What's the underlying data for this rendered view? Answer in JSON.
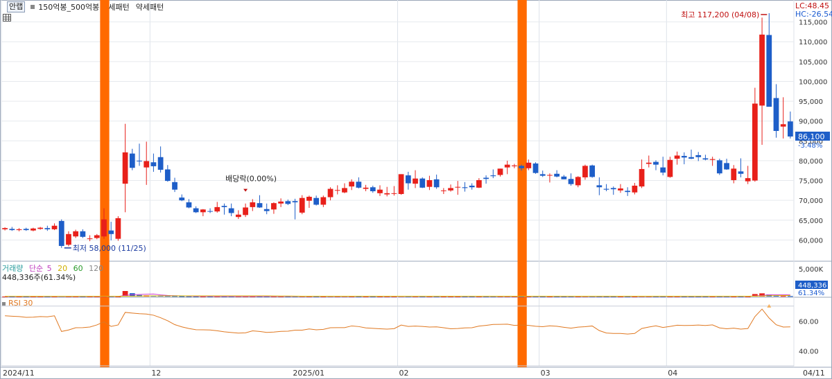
{
  "toolbar": {
    "button_label": "안랩",
    "items": [
      "150억봉_500억봉",
      "강세패턴",
      "약세패턴"
    ]
  },
  "price_panel": {
    "lc_label": "LC:48.45",
    "hc_label": "HC:-26.54",
    "current_price": "86,100",
    "change_pct": "-3.48%",
    "high_annotation": "최고 117,200 (04/08)",
    "low_annotation": "최저 58,000 (11/25)",
    "dividend_annotation": "배당락(0.00%)"
  },
  "volume_panel": {
    "legend": [
      {
        "text": "거래량",
        "color": "#2a9d9d"
      },
      {
        "text": "단순",
        "color": "#c040c0"
      },
      {
        "text": "5",
        "color": "#c040c0"
      },
      {
        "text": "20",
        "color": "#d0b000"
      },
      {
        "text": "60",
        "color": "#2a9a2a"
      },
      {
        "text": "120",
        "color": "#888888"
      }
    ],
    "value_text": "448,336주(61.34%)",
    "axis_badge": "448,336",
    "axis_pct": "61.34%"
  },
  "rsi_panel": {
    "legend": "RSI 30"
  },
  "colors": {
    "up": "#e8201a",
    "down": "#1e5ec8",
    "highlight": "#ff6a00",
    "rsi": "#e07820",
    "ma5": "#d040d0",
    "ma20": "#e0c000"
  },
  "chart_data": [
    {
      "type": "candlestick",
      "title": "",
      "x_tick_labels": [
        "2024/11",
        "12",
        "2025/01",
        "02",
        "03",
        "04",
        "04/11"
      ],
      "y_tick_labels": [
        "60,000",
        "65,000",
        "70,000",
        "75,000",
        "80,000",
        "85,000",
        "90,000",
        "95,000",
        "100,000",
        "105,000",
        "110,000",
        "115,000"
      ],
      "ylim": [
        55000,
        120000
      ],
      "highlighted_sessions": [
        14,
        73
      ],
      "ohlc": [
        [
          62700,
          63200,
          62400,
          63000
        ],
        [
          62800,
          63300,
          62300,
          62500
        ],
        [
          62500,
          63000,
          62200,
          62700
        ],
        [
          62800,
          63100,
          62300,
          62500
        ],
        [
          62400,
          63100,
          62200,
          62900
        ],
        [
          62800,
          63300,
          62600,
          63100
        ],
        [
          63000,
          63600,
          62300,
          62700
        ],
        [
          62700,
          64200,
          62500,
          63600
        ],
        [
          64800,
          65200,
          58000,
          58500
        ],
        [
          58800,
          62200,
          58400,
          61500
        ],
        [
          60900,
          62600,
          60500,
          62200
        ],
        [
          62200,
          62700,
          60500,
          60800
        ],
        [
          60400,
          61200,
          59700,
          60400
        ],
        [
          60500,
          61500,
          60200,
          61200
        ],
        [
          60900,
          68000,
          60300,
          65200
        ],
        [
          62400,
          64600,
          59900,
          61500
        ],
        [
          60300,
          66000,
          59800,
          65500
        ],
        [
          74200,
          89300,
          67000,
          82100
        ],
        [
          81800,
          83000,
          77600,
          78200
        ],
        [
          80000,
          84300,
          78700,
          79900
        ],
        [
          78300,
          84800,
          73900,
          79900
        ],
        [
          79600,
          81800,
          77200,
          78600
        ],
        [
          80900,
          83600,
          77000,
          77700
        ],
        [
          77800,
          78900,
          74700,
          74900
        ],
        [
          74600,
          75700,
          72100,
          72700
        ],
        [
          70700,
          71500,
          69800,
          70000
        ],
        [
          69500,
          70300,
          68000,
          68200
        ],
        [
          68000,
          68500,
          66800,
          67000
        ],
        [
          67000,
          67800,
          66000,
          67700
        ],
        [
          67300,
          68000,
          66800,
          67200
        ],
        [
          67200,
          69600,
          66900,
          68300
        ],
        [
          68600,
          69200,
          66400,
          68300
        ],
        [
          68000,
          69200,
          66000,
          66800
        ],
        [
          65800,
          67500,
          65300,
          66400
        ],
        [
          66300,
          69200,
          65800,
          68200
        ],
        [
          68300,
          70300,
          67300,
          69500
        ],
        [
          69300,
          71300,
          68100,
          68200
        ],
        [
          67800,
          69200,
          66500,
          67300
        ],
        [
          67700,
          69500,
          66600,
          69300
        ],
        [
          69200,
          70500,
          68300,
          69700
        ],
        [
          69800,
          70200,
          68800,
          69100
        ],
        [
          69800,
          70400,
          65200,
          69500
        ],
        [
          66900,
          71300,
          66500,
          70600
        ],
        [
          69900,
          71200,
          68100,
          70900
        ],
        [
          70600,
          71200,
          68700,
          68900
        ],
        [
          68900,
          71200,
          68300,
          70800
        ],
        [
          70800,
          73300,
          70000,
          72900
        ],
        [
          72500,
          73800,
          71500,
          72600
        ],
        [
          72000,
          74300,
          71800,
          73100
        ],
        [
          73500,
          75300,
          72600,
          74700
        ],
        [
          74700,
          75800,
          73000,
          73200
        ],
        [
          72900,
          73900,
          72300,
          73200
        ],
        [
          73300,
          73700,
          71900,
          72300
        ],
        [
          71800,
          73800,
          71100,
          72700
        ],
        [
          71500,
          73400,
          71000,
          71800
        ],
        [
          71700,
          73600,
          71200,
          71800
        ],
        [
          71600,
          76600,
          71400,
          76600
        ],
        [
          76300,
          77200,
          72700,
          74300
        ],
        [
          74200,
          77600,
          73100,
          75500
        ],
        [
          75500,
          75800,
          73100,
          73200
        ],
        [
          73400,
          76200,
          72600,
          75100
        ],
        [
          75300,
          76500,
          72900,
          73300
        ],
        [
          72400,
          73100,
          71600,
          72500
        ],
        [
          72500,
          74000,
          72200,
          73100
        ],
        [
          73400,
          74900,
          71400,
          73400
        ],
        [
          73300,
          74600,
          72200,
          73100
        ],
        [
          73700,
          74300,
          72700,
          73300
        ],
        [
          73200,
          75600,
          73100,
          75100
        ],
        [
          75700,
          76300,
          74200,
          75400
        ],
        [
          76300,
          77800,
          75600,
          76100
        ],
        [
          76400,
          78000,
          76000,
          78000
        ],
        [
          78300,
          80000,
          76600,
          79000
        ],
        [
          78600,
          79200,
          78100,
          78800
        ],
        [
          78700,
          79000,
          77500,
          78100
        ],
        [
          78100,
          80300,
          77600,
          79500
        ],
        [
          79300,
          79600,
          76700,
          76900
        ],
        [
          76600,
          77500,
          75900,
          76200
        ],
        [
          76400,
          76800,
          74500,
          76400
        ],
        [
          76700,
          77600,
          75800,
          76000
        ],
        [
          76000,
          76400,
          75300,
          75300
        ],
        [
          75400,
          76800,
          73700,
          74100
        ],
        [
          73800,
          76100,
          73300,
          75900
        ],
        [
          75800,
          79000,
          75200,
          78700
        ],
        [
          78800,
          79000,
          75700,
          75900
        ],
        [
          73800,
          75800,
          71300,
          73300
        ],
        [
          72900,
          74100,
          72300,
          72700
        ],
        [
          73100,
          73500,
          71400,
          72800
        ],
        [
          72500,
          74100,
          71900,
          73000
        ],
        [
          72400,
          73300,
          71100,
          72100
        ],
        [
          72000,
          74400,
          71500,
          73700
        ],
        [
          73500,
          80300,
          73100,
          77900
        ],
        [
          79200,
          81300,
          78300,
          79500
        ],
        [
          79700,
          80100,
          77600,
          79000
        ],
        [
          78300,
          81000,
          76300,
          77000
        ],
        [
          75900,
          81000,
          75700,
          80200
        ],
        [
          80500,
          82300,
          79000,
          81300
        ],
        [
          81200,
          82100,
          79100,
          80800
        ],
        [
          80900,
          82800,
          80400,
          80500
        ],
        [
          81400,
          82200,
          79900,
          80900
        ],
        [
          80600,
          81500,
          80100,
          80300
        ],
        [
          80200,
          81000,
          78700,
          80400
        ],
        [
          80100,
          80500,
          76400,
          76800
        ],
        [
          79400,
          80500,
          77700,
          77800
        ],
        [
          75100,
          78900,
          74300,
          78000
        ],
        [
          77300,
          80600,
          75800,
          76700
        ],
        [
          74800,
          78700,
          74100,
          75600
        ],
        [
          75000,
          98400,
          74700,
          94400
        ],
        [
          93900,
          116100,
          84000,
          111800
        ],
        [
          111700,
          117200,
          94200,
          93600
        ],
        [
          95800,
          99300,
          85800,
          87500
        ],
        [
          88600,
          96000,
          85600,
          89200
        ],
        [
          89900,
          92400,
          85600,
          86100
        ]
      ],
      "up_color": "#e8201a",
      "down_color": "#1e5ec8"
    },
    {
      "type": "bar",
      "title": "거래량",
      "y_tick_labels": [
        "5,000K"
      ],
      "volume": [
        6,
        3,
        3,
        2,
        3,
        4,
        5,
        8,
        60,
        16,
        10,
        4,
        6,
        4,
        25,
        40,
        12,
        1000,
        600,
        280,
        210,
        180,
        200,
        110,
        90,
        60,
        40,
        30,
        30,
        30,
        35,
        25,
        30,
        40,
        35,
        30,
        25,
        25,
        30,
        30,
        25,
        40,
        50,
        30,
        25,
        20,
        60,
        40,
        60,
        30,
        20,
        20,
        18,
        15,
        25,
        25,
        80,
        50,
        40,
        30,
        30,
        30,
        20,
        20,
        20,
        20,
        20,
        25,
        30,
        40,
        40,
        40,
        30,
        20,
        30,
        30,
        20,
        20,
        20,
        20,
        30,
        30,
        60,
        50,
        30,
        20,
        20,
        20,
        20,
        20,
        60,
        50,
        30,
        30,
        30,
        30,
        20,
        20,
        20,
        20,
        30,
        30,
        30,
        20,
        20,
        20,
        450,
        580,
        380,
        150,
        100,
        90
      ],
      "ma5": [
        15,
        15,
        15,
        15,
        15,
        15,
        15,
        15,
        20,
        20,
        20,
        20,
        20,
        20,
        20,
        25,
        30,
        200,
        330,
        380,
        420,
        450,
        300,
        200,
        160,
        130,
        95,
        70,
        50,
        40,
        35,
        35,
        35,
        35,
        35,
        35,
        35,
        35,
        35,
        30,
        30,
        30,
        30,
        30,
        30,
        30,
        30,
        30,
        30,
        30,
        30,
        30,
        30,
        30,
        30,
        30,
        30,
        30,
        30,
        30,
        30,
        30,
        30,
        30,
        30,
        30,
        30,
        30,
        30,
        30,
        30,
        30,
        30,
        30,
        30,
        30,
        30,
        30,
        30,
        30,
        30,
        30,
        35,
        35,
        35,
        35,
        35,
        35,
        35,
        35,
        35,
        35,
        35,
        35,
        35,
        35,
        35,
        35,
        35,
        35,
        35,
        35,
        35,
        35,
        35,
        35,
        120,
        200,
        320,
        330,
        330,
        300
      ],
      "ma20": [
        50,
        50,
        50,
        50,
        50,
        50,
        50,
        50,
        50,
        50,
        50,
        50,
        50,
        50,
        50,
        50,
        50,
        60,
        80,
        100,
        110,
        120,
        130,
        130,
        130,
        130,
        130,
        130,
        130,
        130,
        130,
        130,
        130,
        130,
        130,
        130,
        130,
        120,
        110,
        100,
        90,
        80,
        70,
        60,
        60,
        60,
        60,
        60,
        60,
        60,
        60,
        60,
        60,
        60,
        60,
        60,
        60,
        60,
        60,
        60,
        60,
        60,
        60,
        60,
        60,
        60,
        60,
        60,
        60,
        60,
        60,
        60,
        60,
        60,
        60,
        60,
        60,
        60,
        60,
        60,
        60,
        60,
        60,
        60,
        60,
        60,
        60,
        60,
        60,
        60,
        60,
        60,
        60,
        60,
        60,
        60,
        60,
        60,
        60,
        60,
        60,
        60,
        60,
        60,
        60,
        60,
        80,
        110,
        150,
        170,
        180,
        190
      ],
      "ylim": [
        0,
        5000
      ]
    },
    {
      "type": "line",
      "title": "RSI 30",
      "y_tick_labels": [
        "40.00",
        "60.00"
      ],
      "ylim": [
        30,
        75
      ],
      "rsi": [
        63.5,
        63.2,
        63,
        62.5,
        62.6,
        63,
        62.8,
        63.5,
        53,
        54,
        55.5,
        55.6,
        56,
        57.4,
        59.5,
        56.4,
        57.4,
        65.8,
        65.3,
        64.9,
        64.7,
        63.9,
        62.2,
        60.2,
        57.6,
        56.1,
        55,
        54.2,
        54.1,
        54,
        53.5,
        52.8,
        52.3,
        51.9,
        52.1,
        53.4,
        53,
        52.4,
        52.6,
        53.1,
        53.2,
        53.9,
        53.9,
        54.7,
        54.1,
        54.4,
        55.5,
        55.6,
        55.6,
        56.7,
        56.3,
        55.4,
        55.1,
        54.8,
        54.6,
        54.9,
        57.3,
        56.4,
        56.6,
        56.4,
        56,
        56.1,
        55.5,
        54.8,
        55,
        55.4,
        55.5,
        56.6,
        57.1,
        57.7,
        57.8,
        57.9,
        57.1,
        57.3,
        57.1,
        56.5,
        56.2,
        56.8,
        56.5,
        55.8,
        55.2,
        55.9,
        56.2,
        56.7,
        53.6,
        52,
        51.7,
        51.7,
        51.3,
        51.7,
        55,
        56,
        56.8,
        55.7,
        56.4,
        57.2,
        57,
        57.1,
        57.3,
        57,
        57.4,
        55.4,
        54.8,
        55.2,
        54.6,
        55,
        63,
        68,
        62,
        57.5,
        56,
        56.1
      ]
    }
  ]
}
